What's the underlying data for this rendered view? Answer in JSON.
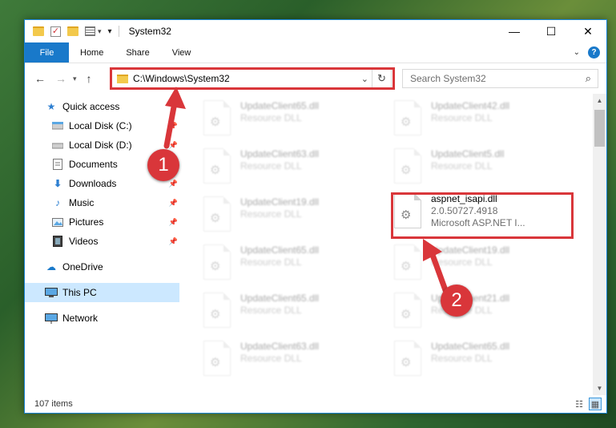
{
  "window": {
    "title": "System32",
    "controls": {
      "minimize": "—",
      "maximize": "☐",
      "close": "✕"
    }
  },
  "ribbon": {
    "file_tab": "File",
    "tabs": [
      "Home",
      "Share",
      "View"
    ],
    "help": "?"
  },
  "navigation": {
    "address_path": "C:\\Windows\\System32",
    "search_placeholder": "Search System32"
  },
  "sidebar": {
    "items": [
      {
        "label": "Quick access",
        "icon": "star-icon",
        "pinned": false
      },
      {
        "label": "Local Disk (C:)",
        "icon": "drive-icon",
        "pinned": true
      },
      {
        "label": "Local Disk (D:)",
        "icon": "drive-icon",
        "pinned": true
      },
      {
        "label": "Documents",
        "icon": "documents-icon",
        "pinned": true
      },
      {
        "label": "Downloads",
        "icon": "download-icon",
        "pinned": true
      },
      {
        "label": "Music",
        "icon": "music-icon",
        "pinned": true
      },
      {
        "label": "Pictures",
        "icon": "pictures-icon",
        "pinned": true
      },
      {
        "label": "Videos",
        "icon": "videos-icon",
        "pinned": true
      },
      {
        "label": "OneDrive",
        "icon": "cloud-icon",
        "pinned": false
      },
      {
        "label": "This PC",
        "icon": "computer-icon",
        "pinned": false,
        "selected": true
      },
      {
        "label": "Network",
        "icon": "network-icon",
        "pinned": false
      }
    ]
  },
  "files": {
    "left_column": [
      {
        "name": "UpdateClient65.dll",
        "type": "Resource DLL"
      },
      {
        "name": "UpdateClient63.dll",
        "type": "Resource DLL"
      },
      {
        "name": "UpdateClient19.dll",
        "type": "Resource DLL"
      },
      {
        "name": "UpdateClient65.dll",
        "type": "Resource DLL"
      },
      {
        "name": "UpdateClient65.dll",
        "type": "Resource DLL"
      },
      {
        "name": "UpdateClient63.dll",
        "type": "Resource DLL"
      }
    ],
    "right_column": [
      {
        "name": "UpdateClient42.dll",
        "type": "Resource DLL"
      },
      {
        "name": "UpdateClient5.dll",
        "type": "Resource DLL"
      },
      {
        "name": "aspnet_isapi.dll",
        "version": "2.0.50727.4918",
        "type": "Microsoft ASP.NET I...",
        "highlighted": true
      },
      {
        "name": "UpdateClient19.dll",
        "type": "Resource DLL"
      },
      {
        "name": "UpdateClient21.dll",
        "type": "Resource DLL"
      },
      {
        "name": "UpdateClient65.dll",
        "type": "Resource DLL"
      }
    ]
  },
  "status": {
    "item_count": "107 items"
  },
  "callouts": {
    "one": "1",
    "two": "2"
  },
  "colors": {
    "accent": "#1979ca",
    "highlight": "#d9363a",
    "selected": "#cce8ff"
  }
}
